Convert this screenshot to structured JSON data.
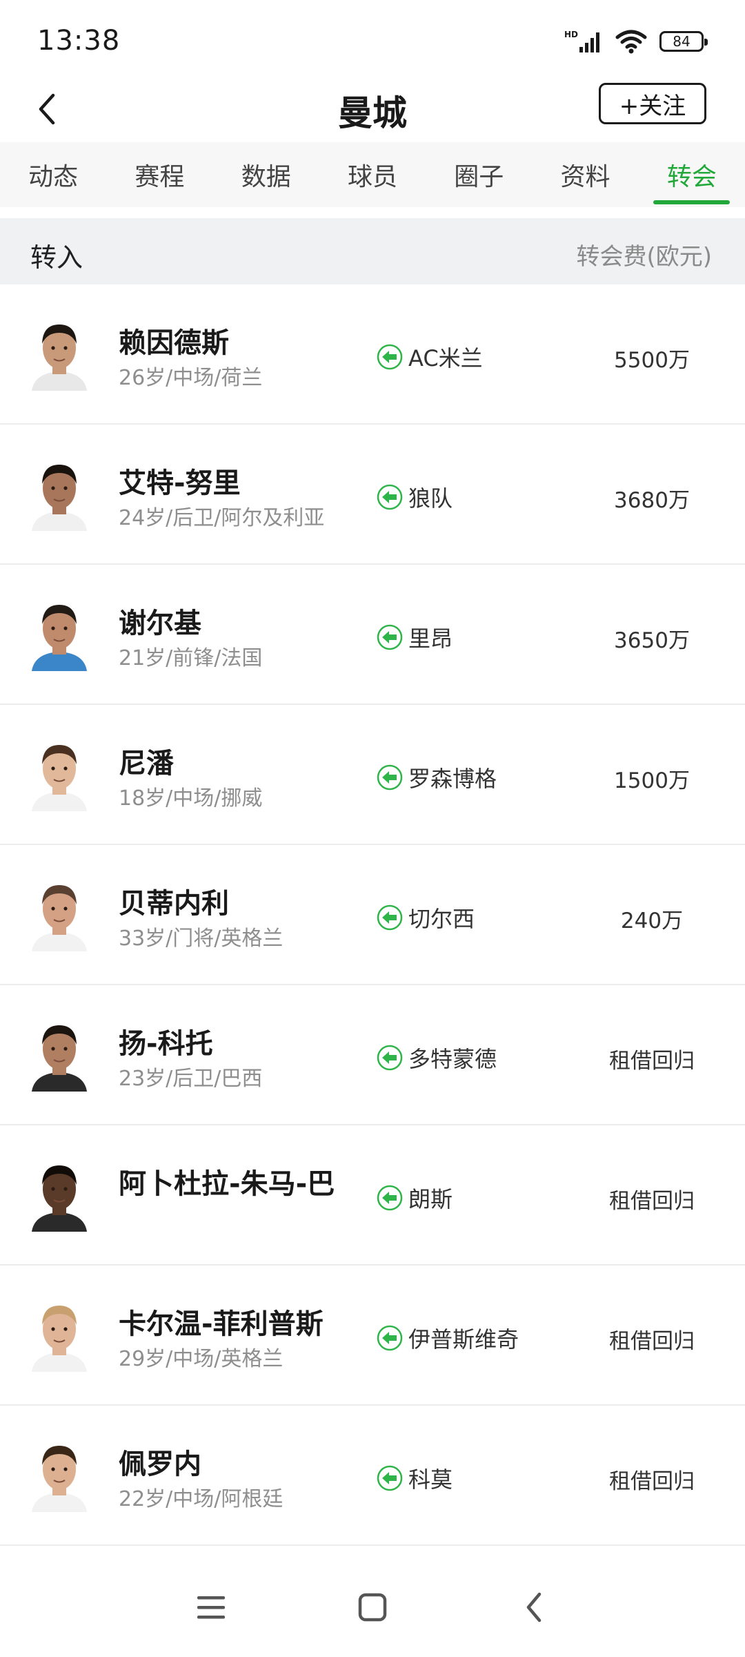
{
  "status_bar": {
    "time": "13:38",
    "network_label": "HD",
    "battery": "84"
  },
  "header": {
    "title": "曼城",
    "follow_label": "+关注"
  },
  "tabs": [
    {
      "label": "动态",
      "active": false
    },
    {
      "label": "赛程",
      "active": false
    },
    {
      "label": "数据",
      "active": false
    },
    {
      "label": "球员",
      "active": false
    },
    {
      "label": "圈子",
      "active": false
    },
    {
      "label": "资料",
      "active": false
    },
    {
      "label": "转会",
      "active": true
    }
  ],
  "section": {
    "title": "转入",
    "fee_label": "转会费(欧元)"
  },
  "players": [
    {
      "name": "赖因德斯",
      "info": "26岁/中场/荷兰",
      "from": "AC米兰",
      "fee": "5500万"
    },
    {
      "name": "艾特-努里",
      "info": "24岁/后卫/阿尔及利亚",
      "from": "狼队",
      "fee": "3680万"
    },
    {
      "name": "谢尔基",
      "info": "21岁/前锋/法国",
      "from": "里昂",
      "fee": "3650万"
    },
    {
      "name": "尼潘",
      "info": "18岁/中场/挪威",
      "from": "罗森博格",
      "fee": "1500万"
    },
    {
      "name": "贝蒂内利",
      "info": "33岁/门将/英格兰",
      "from": "切尔西",
      "fee": "240万"
    },
    {
      "name": "扬-科托",
      "info": "23岁/后卫/巴西",
      "from": "多特蒙德",
      "fee": "租借回归"
    },
    {
      "name": "阿卜杜拉-朱马-巴",
      "info": "",
      "from": "朗斯",
      "fee": "租借回归"
    },
    {
      "name": "卡尔温-菲利普斯",
      "info": "29岁/中场/英格兰",
      "from": "伊普斯维奇",
      "fee": "租借回归"
    },
    {
      "name": "佩罗内",
      "info": "22岁/中场/阿根廷",
      "from": "科莫",
      "fee": "租借回归"
    }
  ],
  "avatars": [
    {
      "skin": "#c89a7a",
      "hair": "#1e1610",
      "shirt": "#e8e8e8"
    },
    {
      "skin": "#a8765a",
      "hair": "#1a120c",
      "shirt": "#f0f0f0"
    },
    {
      "skin": "#c08b6c",
      "hair": "#221a14",
      "shirt": "#3a86c8"
    },
    {
      "skin": "#e2b89a",
      "hair": "#4a3020",
      "shirt": "#f2f2f2"
    },
    {
      "skin": "#d4a184",
      "hair": "#5a4030",
      "shirt": "#f2f2f2"
    },
    {
      "skin": "#b07e60",
      "hair": "#1c140e",
      "shirt": "#2a2a2a"
    },
    {
      "skin": "#5a3a28",
      "hair": "#120c08",
      "shirt": "#2a2a2a"
    },
    {
      "skin": "#e0b496",
      "hair": "#c8a070",
      "shirt": "#f2f2f2"
    },
    {
      "skin": "#dcb090",
      "hair": "#3a2616",
      "shirt": "#f2f2f2"
    }
  ],
  "colors": {
    "accent": "#22a83a",
    "arrow_fill": "#2fb44a"
  },
  "icons": {
    "back": "chevron-left-icon",
    "transfer_in": "arrow-left-circle-icon",
    "nav_menu": "menu-icon",
    "nav_home": "square-home-icon",
    "nav_back": "chevron-back-icon"
  }
}
